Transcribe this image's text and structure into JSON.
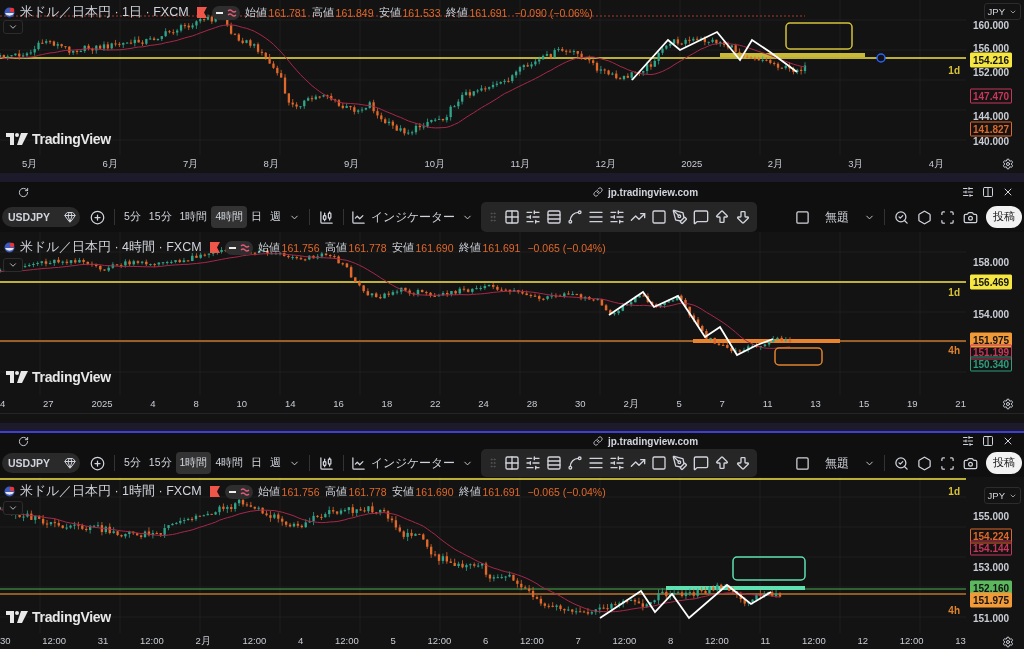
{
  "panels": [
    {
      "legend": {
        "title": "米ドル／日本円 · 1日 · FXCM",
        "fields": [
          {
            "label": "始値",
            "value": "161.781"
          },
          {
            "label": "高値",
            "value": "161.849"
          },
          {
            "label": "安値",
            "value": "161.533"
          },
          {
            "label": "終値",
            "value": "161.691"
          }
        ],
        "change": "−0.090 (−0.06%)"
      },
      "currency": "JPY",
      "logo": "TradingView",
      "price_axis": [
        {
          "kind": "tick",
          "text": "160.000"
        },
        {
          "kind": "tick",
          "text": "156.000"
        },
        {
          "kind": "badge",
          "text": "154.216",
          "color": "#f5e642"
        },
        {
          "kind": "tag",
          "text": "1d",
          "color": "#d8c23a"
        },
        {
          "kind": "tick",
          "text": "152.000"
        },
        {
          "kind": "outline",
          "text": "147.470",
          "color": "#c8365a"
        },
        {
          "kind": "tick",
          "text": "144.000"
        },
        {
          "kind": "outline",
          "text": "141.827",
          "color": "#e0682a"
        },
        {
          "kind": "tick",
          "text": "140.000"
        }
      ],
      "time_axis": [
        "5月",
        "6月",
        "7月",
        "8月",
        "9月",
        "10月",
        "11月",
        "12月",
        "2025",
        "2月",
        "3月",
        "4月"
      ]
    },
    {
      "window": {
        "url": "jp.tradingview.com"
      },
      "toolbar": {
        "symbol": "USDJPY",
        "intervals": [
          {
            "label": "5分",
            "selected": false
          },
          {
            "label": "15分",
            "selected": false
          },
          {
            "label": "1時間",
            "selected": false
          },
          {
            "label": "4時間",
            "selected": true
          },
          {
            "label": "日",
            "selected": false
          },
          {
            "label": "週",
            "selected": false
          }
        ],
        "indicators": "インジケーター",
        "layout_name": "無題",
        "publish": "投稿"
      },
      "legend": {
        "title": "米ドル／日本円 · 4時間 · FXCM",
        "fields": [
          {
            "label": "始値",
            "value": "161.756"
          },
          {
            "label": "高値",
            "value": "161.778"
          },
          {
            "label": "安値",
            "value": "161.690"
          },
          {
            "label": "終値",
            "value": "161.691"
          }
        ],
        "change": "−0.065 (−0.04%)"
      },
      "logo": "TradingView",
      "price_axis": [
        {
          "kind": "tick",
          "text": "158.000"
        },
        {
          "kind": "badge",
          "text": "156.469",
          "color": "#f5e642"
        },
        {
          "kind": "tag",
          "text": "1d",
          "color": "#d8c23a"
        },
        {
          "kind": "tick",
          "text": "154.000"
        },
        {
          "kind": "badge",
          "text": "151.975",
          "color": "#f29a38"
        },
        {
          "kind": "tag",
          "text": "4h",
          "color": "#e0832e"
        },
        {
          "kind": "outline",
          "text": "151.199",
          "color": "#c8365a"
        },
        {
          "kind": "outline",
          "text": "150.340",
          "color": "#2e9e7e"
        }
      ],
      "time_axis": [
        "4",
        "27",
        "2025",
        "4",
        "8",
        "10",
        "14",
        "16",
        "18",
        "22",
        "24",
        "28",
        "30",
        "2月",
        "5",
        "7",
        "11",
        "13",
        "15",
        "19",
        "21"
      ]
    },
    {
      "window": {
        "url": "jp.tradingview.com"
      },
      "toolbar": {
        "symbol": "USDJPY",
        "intervals": [
          {
            "label": "5分",
            "selected": false
          },
          {
            "label": "15分",
            "selected": false
          },
          {
            "label": "1時間",
            "selected": true
          },
          {
            "label": "4時間",
            "selected": false
          },
          {
            "label": "日",
            "selected": false
          },
          {
            "label": "週",
            "selected": false
          }
        ],
        "indicators": "インジケーター",
        "layout_name": "無題",
        "publish": "投稿"
      },
      "legend": {
        "title": "米ドル／日本円 · 1時間 · FXCM",
        "fields": [
          {
            "label": "始値",
            "value": "161.756"
          },
          {
            "label": "高値",
            "value": "161.778"
          },
          {
            "label": "安値",
            "value": "161.690"
          },
          {
            "label": "終値",
            "value": "161.691"
          }
        ],
        "change": "−0.065 (−0.04%)"
      },
      "currency": "JPY",
      "logo": "TradingView",
      "price_axis": [
        {
          "kind": "tag",
          "text": "1d",
          "color": "#d8c23a"
        },
        {
          "kind": "tick",
          "text": "155.000"
        },
        {
          "kind": "outline",
          "text": "154.224",
          "color": "#e0682a"
        },
        {
          "kind": "outline",
          "text": "154.144",
          "color": "#c8365a"
        },
        {
          "kind": "tick",
          "text": "153.000"
        },
        {
          "kind": "badge",
          "text": "152.160",
          "color": "#5cb85c"
        },
        {
          "kind": "badge",
          "text": "151.975",
          "color": "#f29a38"
        },
        {
          "kind": "tag",
          "text": "4h",
          "color": "#e0832e"
        },
        {
          "kind": "tick",
          "text": "151.000"
        }
      ],
      "time_axis": [
        "30",
        "12:00",
        "31",
        "12:00",
        "2月",
        "12:00",
        "4",
        "12:00",
        "5",
        "12:00",
        "6",
        "12:00",
        "7",
        "12:00",
        "8",
        "12:00",
        "11",
        "12:00",
        "12",
        "12:00",
        "13"
      ]
    }
  ]
}
